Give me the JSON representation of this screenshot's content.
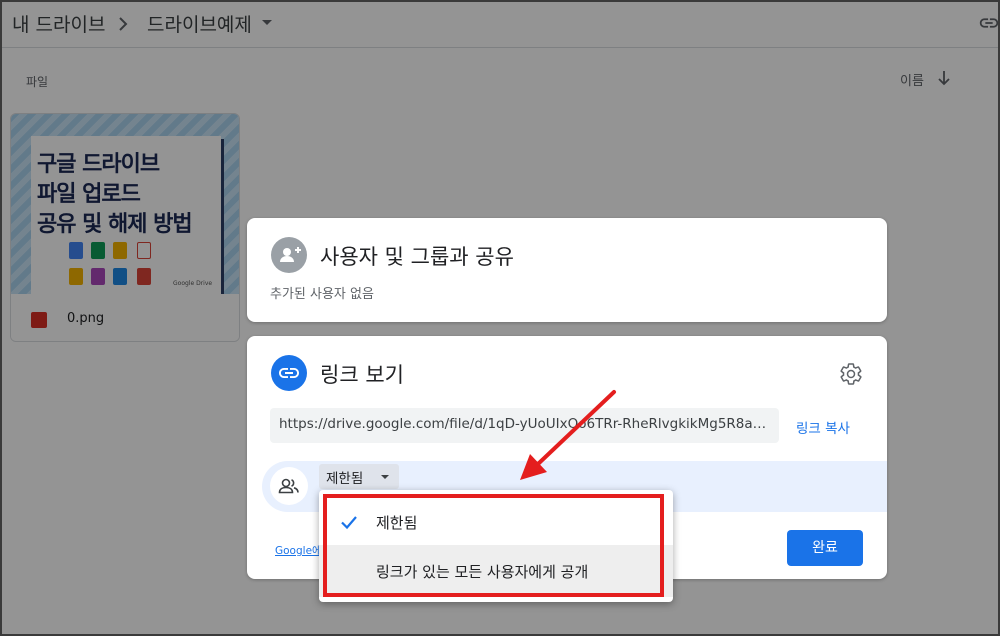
{
  "breadcrumb": {
    "root": "내 드라이브",
    "current": "드라이브예제"
  },
  "files_section": {
    "label": "파일",
    "sort_label": "이름"
  },
  "file": {
    "name": "0.png",
    "thumbnail_lines": [
      "구글 드라이브",
      "파일 업로드",
      "공유 및 해제 방법"
    ],
    "thumbnail_logo": "Google Drive"
  },
  "share_panel": {
    "title": "사용자 및 그룹과 공유",
    "subtitle": "추가된 사용자 없음"
  },
  "link_panel": {
    "title": "링크 보기",
    "url": "https://drive.google.com/file/d/1qD-yUoUIxQo6TRr-RheRlvgkikMg5R8a/vie...",
    "copy_label": "링크 복사",
    "access_value": "제한됨",
    "learn_more": "Google에",
    "done_label": "완료"
  },
  "access_menu": {
    "options": [
      {
        "label": "제한됨",
        "selected": true
      },
      {
        "label": "링크가 있는 모든 사용자에게 공개",
        "selected": false
      }
    ]
  },
  "colors": {
    "accent": "#1a73e8",
    "annotation": "#e41e1e",
    "share_icon_bg": "#9aa0a6"
  }
}
